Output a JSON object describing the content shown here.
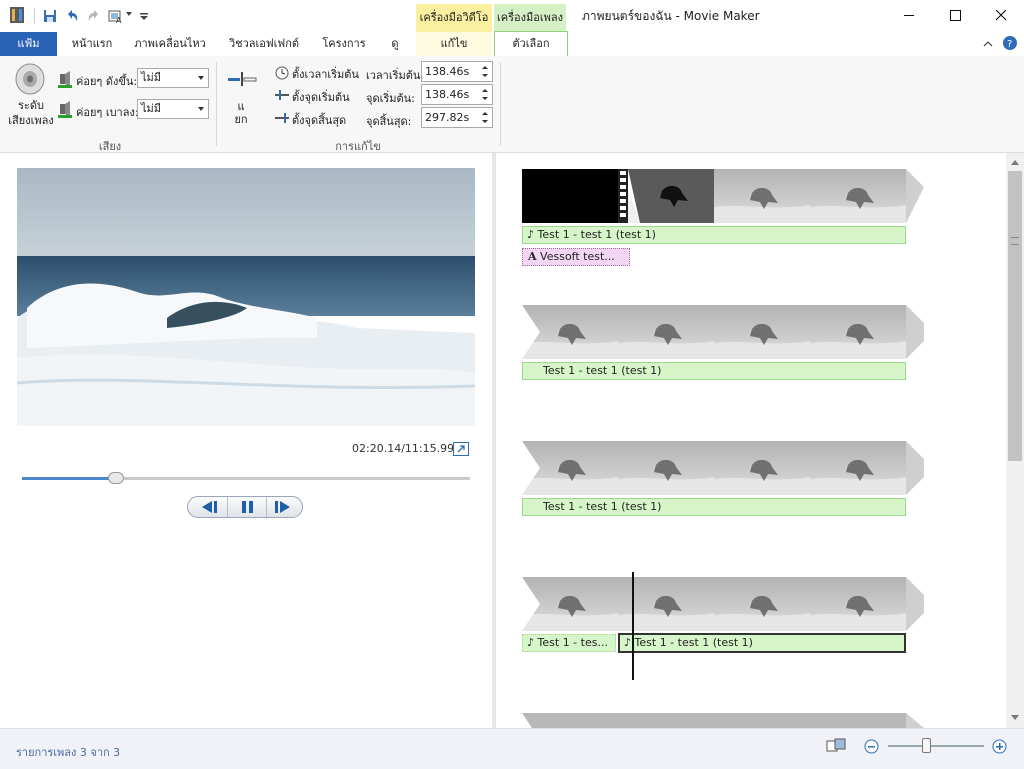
{
  "window": {
    "title": "ภาพยนตร์ของฉัน - Movie Maker",
    "context_tabs": [
      "เครื่องมือวิดีโอ",
      "เครื่องมือเพลง"
    ]
  },
  "tabs": {
    "file": "แฟ้ม",
    "items": [
      "หน้าแรก",
      "ภาพเคลื่อนไหว",
      "วิชวลเอฟเฟกต์",
      "โครงการ",
      "ดู",
      "แก้ไข",
      "ตัวเลือก"
    ]
  },
  "ribbon": {
    "volume_label": "ระดับ\nเสียงเพลง",
    "fade_in_label": "ค่อยๆ ดังขึ้น:",
    "fade_in_value": "ไม่มี",
    "fade_out_label": "ค่อยๆ เบาลง:",
    "fade_out_value": "ไม่มี",
    "audio_group": "เสียง",
    "split_label": "แ\nยก",
    "set_start_time": "ตั้งเวลาเริ่มต้น",
    "set_start_point": "ตั้งจุดเริ่มต้น",
    "set_end_point": "ตั้งจุดสิ้นสุด",
    "start_time_label": "เวลาเริ่มต้น:",
    "start_time_value": "138.46s",
    "start_point_label": "จุดเริ่มต้น:",
    "start_point_value": "138.46s",
    "end_point_label": "จุดสิ้นสุด:",
    "end_point_value": "297.82s",
    "edit_group": "การแก้ไข"
  },
  "preview": {
    "timecode": "02:20.14/11:15.99",
    "seek_fraction": 0.21
  },
  "storyboard": {
    "caption": "Vessoft test...",
    "audio_clip": "Test 1 - test 1 (test 1)",
    "audio_clip_short": "Test 1 - tes..."
  },
  "status": {
    "text": "รายการเพลง 3 จาก 3",
    "zoom_fraction": 0.4
  },
  "colors": {
    "file_tab": "#2b63b6",
    "video_tools": "#faf0a0",
    "music_tools": "#d6f0c6",
    "audio_bar": "#d6f5c8",
    "caption_bar": "#f3d6f4"
  }
}
